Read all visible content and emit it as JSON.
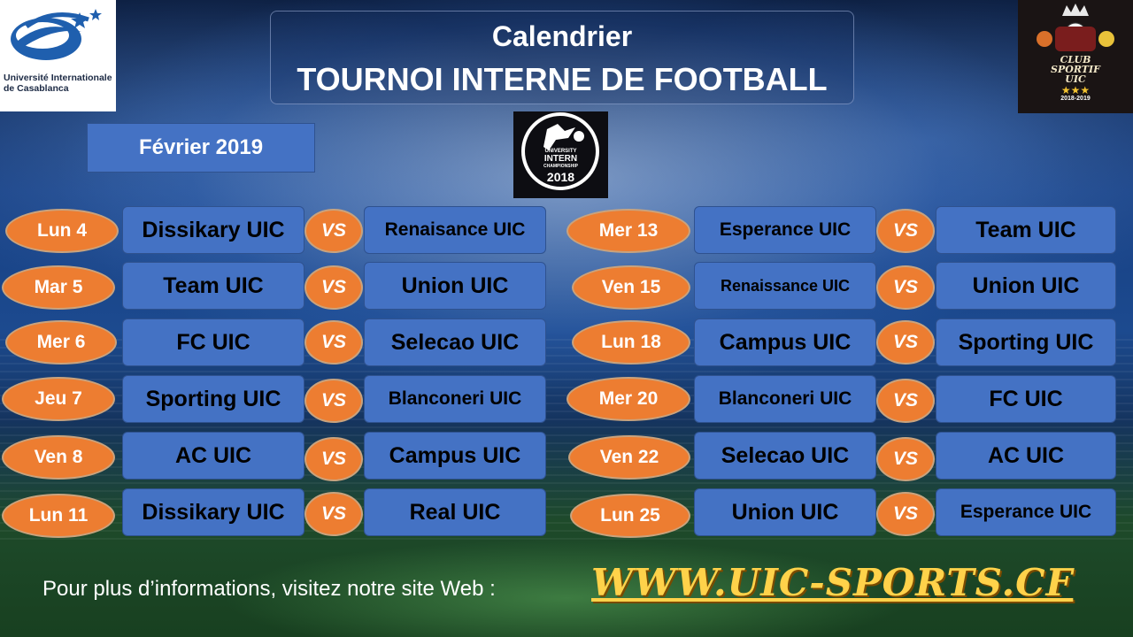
{
  "header": {
    "title_line1": "Calendrier",
    "title_line2": "TOURNOI INTERNE DE FOOTBALL",
    "month": "Février 2019"
  },
  "logos": {
    "university": {
      "line1": "Université Internationale",
      "line2": "de Casablanca"
    },
    "club": {
      "line1": "CLUB",
      "line2": "SPORTIF",
      "line3": "UIC",
      "season": "2018-2019"
    },
    "championship": {
      "line1": "UNIVERSITY",
      "line2": "INTERN",
      "line3": "CHAMPIONSHIP",
      "year": "2018"
    }
  },
  "vs_label": "VS",
  "matches_left": [
    {
      "day": "Lun 4",
      "home": "Dissikary UIC",
      "away": "Renaisance UIC"
    },
    {
      "day": "Mar 5",
      "home": "Team UIC",
      "away": "Union UIC"
    },
    {
      "day": "Mer 6",
      "home": "FC UIC",
      "away": "Selecao UIC"
    },
    {
      "day": "Jeu 7",
      "home": "Sporting UIC",
      "away": "Blanconeri UIC"
    },
    {
      "day": "Ven 8",
      "home": "AC UIC",
      "away": "Campus UIC"
    },
    {
      "day": "Lun 11",
      "home": "Dissikary UIC",
      "away": "Real UIC"
    }
  ],
  "matches_right": [
    {
      "day": "Mer 13",
      "home": "Esperance UIC",
      "away": "Team UIC"
    },
    {
      "day": "Ven 15",
      "home": "Renaissance  UIC",
      "away": "Union UIC"
    },
    {
      "day": "Lun 18",
      "home": "Campus UIC",
      "away": "Sporting UIC"
    },
    {
      "day": "Mer 20",
      "home": "Blanconeri UIC",
      "away": "FC UIC"
    },
    {
      "day": "Ven 22",
      "home": "Selecao UIC",
      "away": "AC UIC"
    },
    {
      "day": "Lun 25",
      "home": "Union UIC",
      "away": "Esperance UIC"
    }
  ],
  "footer": {
    "text": "Pour plus d’informations, visitez notre site Web :",
    "site": "WWW.UIC-SPORTS.CF"
  },
  "colors": {
    "day_badge": "#ed7d31",
    "team_box": "#4472c4",
    "site_link": "#ffd24a"
  }
}
